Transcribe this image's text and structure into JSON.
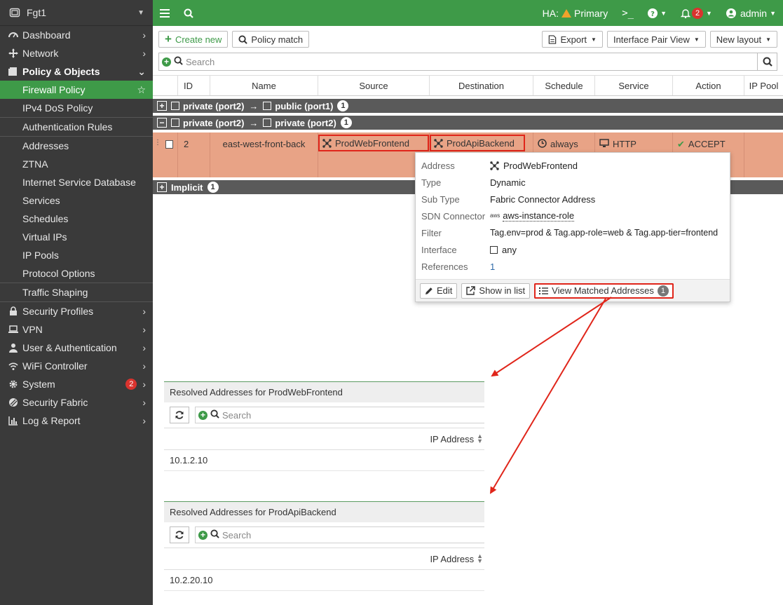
{
  "sidebar": {
    "device": "Fgt1",
    "menu": [
      {
        "label": "Dashboard"
      },
      {
        "label": "Network"
      },
      {
        "label": "Policy & Objects"
      },
      {
        "label": "Firewall Policy"
      },
      {
        "label": "IPv4 DoS Policy"
      },
      {
        "label": "Authentication Rules"
      },
      {
        "label": "Addresses"
      },
      {
        "label": "ZTNA"
      },
      {
        "label": "Internet Service Database"
      },
      {
        "label": "Services"
      },
      {
        "label": "Schedules"
      },
      {
        "label": "Virtual IPs"
      },
      {
        "label": "IP Pools"
      },
      {
        "label": "Protocol Options"
      },
      {
        "label": "Traffic Shaping"
      },
      {
        "label": "Security Profiles"
      },
      {
        "label": "VPN"
      },
      {
        "label": "User & Authentication"
      },
      {
        "label": "WiFi Controller"
      },
      {
        "label": "System",
        "badge": "2"
      },
      {
        "label": "Security Fabric"
      },
      {
        "label": "Log & Report"
      }
    ]
  },
  "topbar": {
    "ha_label": "HA:",
    "ha_status": "Primary",
    "notifications": "2",
    "user": "admin"
  },
  "toolbar": {
    "create_new": "Create new",
    "policy_match": "Policy match",
    "export": "Export",
    "view": "Interface Pair View",
    "new_layout": "New layout"
  },
  "search": {
    "placeholder": "Search"
  },
  "table": {
    "columns": [
      "ID",
      "Name",
      "Source",
      "Destination",
      "Schedule",
      "Service",
      "Action",
      "IP Pool"
    ],
    "groups": [
      {
        "from": "private (port2)",
        "to": "public (port1)",
        "count": "1"
      },
      {
        "from": "private (port2)",
        "to": "private (port2)",
        "count": "1"
      },
      {
        "label": "Implicit",
        "count": "1"
      }
    ],
    "row": {
      "id": "2",
      "name": "east-west-front-back",
      "source": "ProdWebFrontend",
      "destination": "ProdApiBackend",
      "schedule": "always",
      "service": "HTTP",
      "action": "ACCEPT"
    }
  },
  "popup": {
    "fields": [
      {
        "label": "Address",
        "value": "ProdWebFrontend"
      },
      {
        "label": "Type",
        "value": "Dynamic"
      },
      {
        "label": "Sub Type",
        "value": "Fabric Connector Address"
      },
      {
        "label": "SDN Connector",
        "value": "aws-instance-role",
        "icon_text": "aws"
      },
      {
        "label": "Filter",
        "value": "Tag.env=prod & Tag.app-role=web & Tag.app-tier=frontend"
      },
      {
        "label": "Interface",
        "value": "any"
      },
      {
        "label": "References",
        "value": "1"
      }
    ],
    "actions": {
      "edit": "Edit",
      "show_in_list": "Show in list",
      "view_matched": "View Matched Addresses",
      "view_matched_count": "1"
    }
  },
  "resolved": [
    {
      "title": "Resolved Addresses for ProdWebFrontend",
      "search_placeholder": "Search",
      "column": "IP Address",
      "rows": [
        "10.1.2.10"
      ]
    },
    {
      "title": "Resolved Addresses for ProdApiBackend",
      "search_placeholder": "Search",
      "column": "IP Address",
      "rows": [
        "10.2.20.10"
      ]
    }
  ],
  "colors": {
    "brand_green": "#3e9a48",
    "sidebar_bg": "#3a3a3a",
    "row_highlight": "#e8a386",
    "annotation_red": "#e0251a"
  }
}
